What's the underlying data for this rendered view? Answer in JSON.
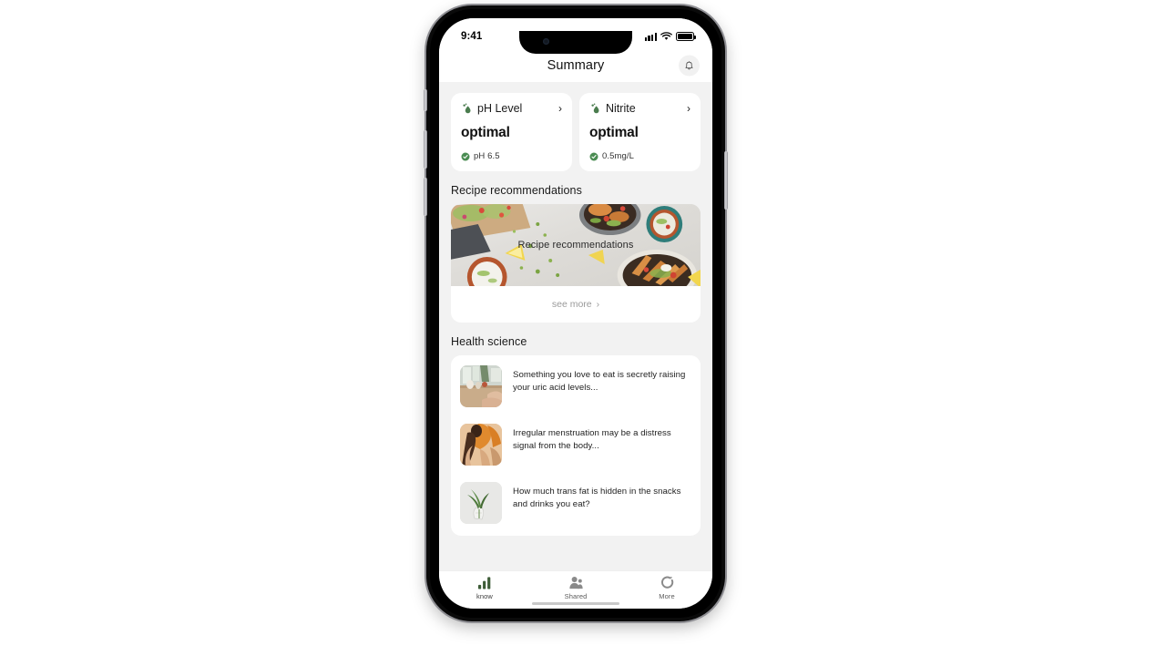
{
  "status_bar": {
    "time": "9:41",
    "signal_icon": "cellular-signal-icon",
    "wifi_icon": "wifi-icon",
    "battery_icon": "battery-icon"
  },
  "nav": {
    "title": "Summary",
    "bell_icon": "bell-icon"
  },
  "metrics": [
    {
      "icon": "droplet-icon",
      "name": "pH Level",
      "chevron": "›",
      "status": "optimal",
      "value": "pH 6.5",
      "check_icon": "check-circle-icon",
      "accent": "#4a7c4e"
    },
    {
      "icon": "droplet-icon",
      "name": "Nitrite",
      "chevron": "›",
      "status": "optimal",
      "value": "0.5mg/L",
      "check_icon": "check-circle-icon",
      "accent": "#4a7c4e"
    }
  ],
  "recipe": {
    "section_title": "Recipe recommendations",
    "hero_label": "Recipe recommendations",
    "see_more_label": "see more",
    "see_more_chevron": "›",
    "image_alt": "food-bowls-photo"
  },
  "health": {
    "section_title": "Health science",
    "articles": [
      {
        "title": "Something you love to eat is secretly raising your uric acid levels...",
        "thumb": "kitchen-table-photo"
      },
      {
        "title": "Irregular menstruation may be a distress signal from the body...",
        "thumb": "stretching-person-photo"
      },
      {
        "title": "How much trans fat is hidden in the snacks and drinks you eat?",
        "thumb": "plant-vase-photo"
      }
    ]
  },
  "tabbar": {
    "items": [
      {
        "label": "know",
        "icon": "bar-chart-icon",
        "active": true
      },
      {
        "label": "Shared",
        "icon": "people-icon",
        "active": false
      },
      {
        "label": "More",
        "icon": "circle-arrow-icon",
        "active": false
      }
    ]
  },
  "theme": {
    "brand_green": "#4a7c4e",
    "tab_active": "#3d5c37",
    "screen_bg": "#f2f2f2",
    "card_bg": "#ffffff"
  }
}
